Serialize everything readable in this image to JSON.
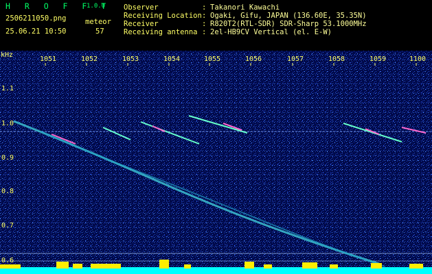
{
  "header": {
    "app_name": "H R O F F T",
    "version": "1.0.0",
    "filename": "2506211050.png",
    "datetime": "25.06.21 10:50",
    "mode_label": "meteor",
    "count": "57",
    "fields": [
      {
        "label": "Observer",
        "sep": ":",
        "value": "Takanori Kawachi"
      },
      {
        "label": "Receiving Location",
        "sep": ":",
        "value": "Ogaki, Gifu, JAPAN (136.60E, 35.35N)"
      },
      {
        "label": "Receiver",
        "sep": ":",
        "value": "R820T2(RTL-SDR) SDR-Sharp 53.1000MHz"
      },
      {
        "label": "Receiving antenna",
        "sep": ":",
        "value": "2el-HB9CV Vertical (el. E-W)"
      }
    ]
  },
  "spectrogram": {
    "y_unit": "kHz",
    "x_ticks": [
      "1051",
      "1052",
      "1053",
      "1054",
      "1055",
      "1056",
      "1057",
      "1058",
      "1059",
      "1100"
    ],
    "y_ticks": [
      "1.1",
      "1.0",
      "0.9",
      "0.8",
      "0.7",
      "0.6"
    ],
    "colors": {
      "background": "#000a4a",
      "noise": "#2040c0",
      "trace": "#66ffcc",
      "level": "#ffee00",
      "base": "#00ffff",
      "axis_text": "#ffff66"
    }
  }
}
